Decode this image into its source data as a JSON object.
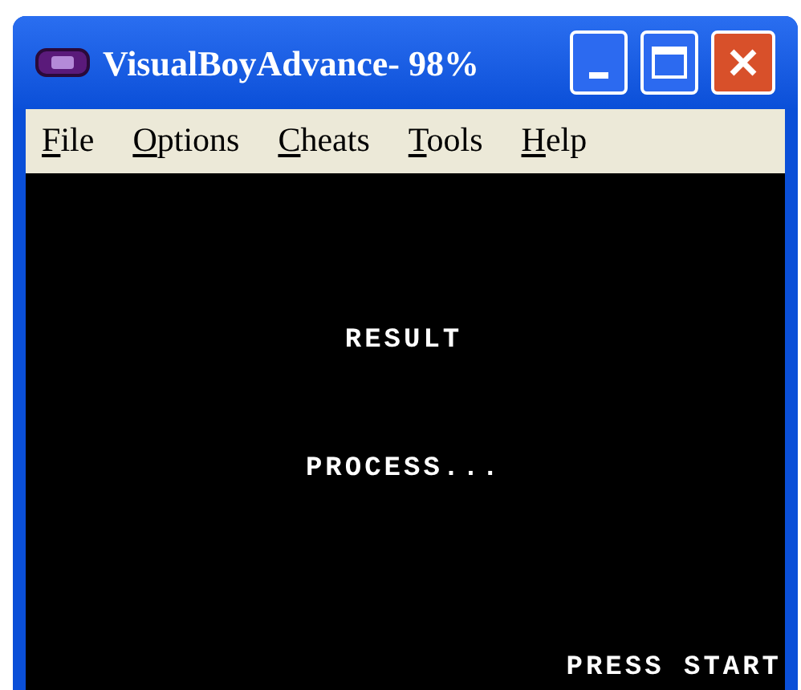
{
  "window": {
    "title": "VisualBoyAdvance- 98%"
  },
  "menu": [
    {
      "label": "File"
    },
    {
      "label": "Options"
    },
    {
      "label": "Cheats"
    },
    {
      "label": "Tools"
    },
    {
      "label": "Help"
    }
  ],
  "screen": {
    "heading": "RESULT",
    "status": "PROCESS...",
    "prompt": "PRESS START"
  }
}
